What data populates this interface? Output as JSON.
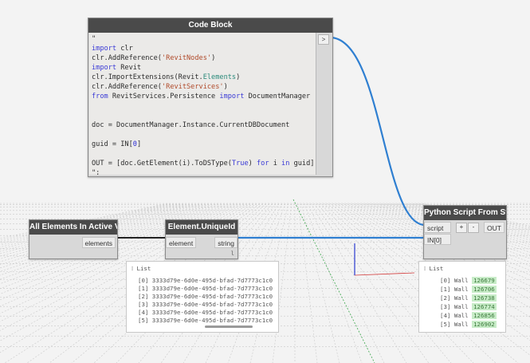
{
  "code_block": {
    "title": "Code Block",
    "out_port": ">",
    "lines": [
      [
        {
          "t": "\""
        }
      ],
      [
        {
          "t": "import",
          "c": "kw"
        },
        {
          "t": " clr"
        }
      ],
      [
        {
          "t": "clr.AddReference("
        },
        {
          "t": "'RevitNodes'",
          "c": "st"
        },
        {
          "t": ")"
        }
      ],
      [
        {
          "t": "import",
          "c": "kw"
        },
        {
          "t": " Revit"
        }
      ],
      [
        {
          "t": "clr.ImportExtensions(Revit."
        },
        {
          "t": "Elements",
          "c": "cl"
        },
        {
          "t": ")"
        }
      ],
      [
        {
          "t": "clr.AddReference("
        },
        {
          "t": "'RevitServices'",
          "c": "st"
        },
        {
          "t": ")"
        }
      ],
      [
        {
          "t": "from",
          "c": "kw"
        },
        {
          "t": " RevitServices.Persistence "
        },
        {
          "t": "import",
          "c": "kw"
        },
        {
          "t": " DocumentManager"
        }
      ],
      [
        {
          "t": ""
        }
      ],
      [
        {
          "t": ""
        }
      ],
      [
        {
          "t": "doc = DocumentManager.Instance.CurrentDBDocument"
        }
      ],
      [
        {
          "t": ""
        }
      ],
      [
        {
          "t": "guid = IN["
        },
        {
          "t": "0",
          "c": "nu"
        },
        {
          "t": "]"
        }
      ],
      [
        {
          "t": ""
        }
      ],
      [
        {
          "t": "OUT = [doc.GetElement(i).ToDSType("
        },
        {
          "t": "True",
          "c": "kw"
        },
        {
          "t": ") "
        },
        {
          "t": "for",
          "c": "kw"
        },
        {
          "t": " i "
        },
        {
          "t": "in",
          "c": "kw"
        },
        {
          "t": " guid]"
        }
      ],
      [
        {
          "t": "\";"
        }
      ]
    ]
  },
  "all_elements": {
    "title": "All Elements In Active View",
    "output": "elements"
  },
  "unique_id": {
    "title": "Element.UniqueId",
    "input": "element",
    "output": "string",
    "lacing": "l"
  },
  "python": {
    "title": "Python Script From String",
    "input_script": "script",
    "input_in": "IN[0]",
    "plus": "+",
    "minus": "-",
    "output": "OUT"
  },
  "watch_uid": {
    "title": "List",
    "rows": [
      "[0] 3333d79e-6d0e-495d-bfad-7d7773c1c0",
      "[1] 3333d79e-6d0e-495d-bfad-7d7773c1c0",
      "[2] 3333d79e-6d0e-495d-bfad-7d7773c1c0",
      "[3] 3333d79e-6d0e-495d-bfad-7d7773c1c0",
      "[4] 3333d79e-6d0e-495d-bfad-7d7773c1c0",
      "[5] 3333d79e-6d0e-495d-bfad-7d7773c1c0"
    ]
  },
  "watch_py": {
    "title": "List",
    "rows": [
      {
        "idx": "[0]",
        "type": "Wall",
        "id": "126679"
      },
      {
        "idx": "[1]",
        "type": "Wall",
        "id": "126706"
      },
      {
        "idx": "[2]",
        "type": "Wall",
        "id": "126738"
      },
      {
        "idx": "[3]",
        "type": "Wall",
        "id": "126774"
      },
      {
        "idx": "[4]",
        "type": "Wall",
        "id": "126856"
      },
      {
        "idx": "[5]",
        "type": "Wall",
        "id": "126902"
      }
    ]
  },
  "colors": {
    "wire": "#2f7fd1",
    "header": "#4a4a4a",
    "node_body": "#d8d8d8",
    "grid_line": "#c9c9c9",
    "id_highlight": "#c8ecc8"
  }
}
